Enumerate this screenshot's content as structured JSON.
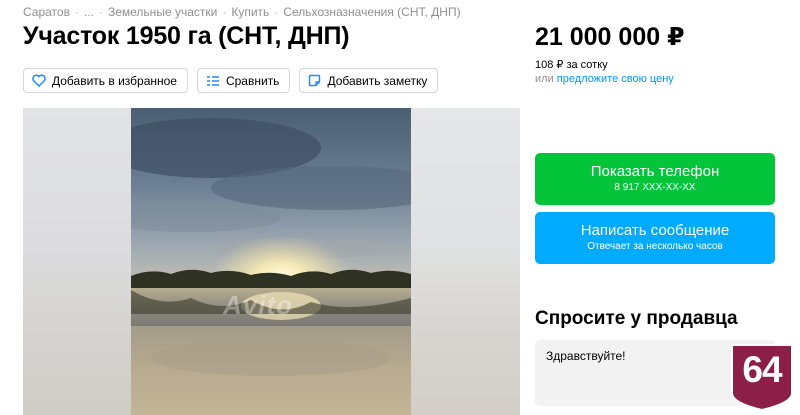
{
  "breadcrumb": [
    "Саратов",
    "...",
    "Земельные участки",
    "Купить",
    "Сельхозназначения (СНТ, ДНП)"
  ],
  "title": "Участок 1950 га (СНТ, ДНП)",
  "actions": {
    "favorite_label": "Добавить в избранное",
    "compare_label": "Сравнить",
    "note_label": "Добавить заметку"
  },
  "gallery": {
    "watermark": "Avito"
  },
  "price": {
    "value": "21 000 000 ₽",
    "per_unit": "108 ₽ за сотку",
    "offer_prefix": "или",
    "offer_link": "предложите свою цену"
  },
  "contact": {
    "phone_label": "Показать телефон",
    "phone_number": "8 917 XXX-XX-XX",
    "message_label": "Написать сообщение",
    "message_sub": "Отвечает за несколько часов"
  },
  "ask": {
    "title": "Спросите у продавца",
    "message": "Здравствуйте!"
  },
  "badge": {
    "text": "64"
  },
  "colors": {
    "accent_blue": "#00aaff",
    "accent_green": "#04c43a",
    "link": "#0099f7",
    "badge": "#8b1f45"
  }
}
